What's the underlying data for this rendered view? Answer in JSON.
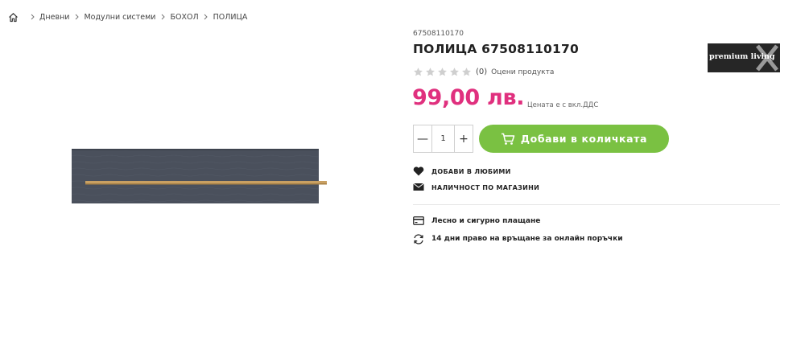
{
  "breadcrumb": {
    "items": [
      "Дневни",
      "Модулни системи",
      "БОХОЛ",
      "ПОЛИЦА"
    ]
  },
  "product": {
    "sku": "67508110170",
    "title": "ПОЛИЦА 67508110170",
    "price": "99,00 лв.",
    "vat_note": "Цената е с вкл.ДДС",
    "rating": {
      "count_label": "(0)",
      "rate_label": "Оцени продукта",
      "stars_filled": 0,
      "stars_total": 5
    },
    "quantity": "1",
    "brand_logo_text": "premium living"
  },
  "actions": {
    "decrease_label": "—",
    "increase_label": "+",
    "add_to_cart_label": "Добави в количката",
    "favorites_label": "ДОБАВИ В ЛЮБИМИ",
    "stores_label": "НАЛИЧНОСТ ПО МАГАЗИНИ"
  },
  "benefits": {
    "payment": "Лесно и сигурно плащане",
    "returns": "14 дни право на връщане за онлайн поръчки"
  },
  "colors": {
    "price": "#e0307e",
    "accent_green": "#7ac142",
    "shelf_body": "#4a505c",
    "shelf_wood": "#c9a062"
  }
}
